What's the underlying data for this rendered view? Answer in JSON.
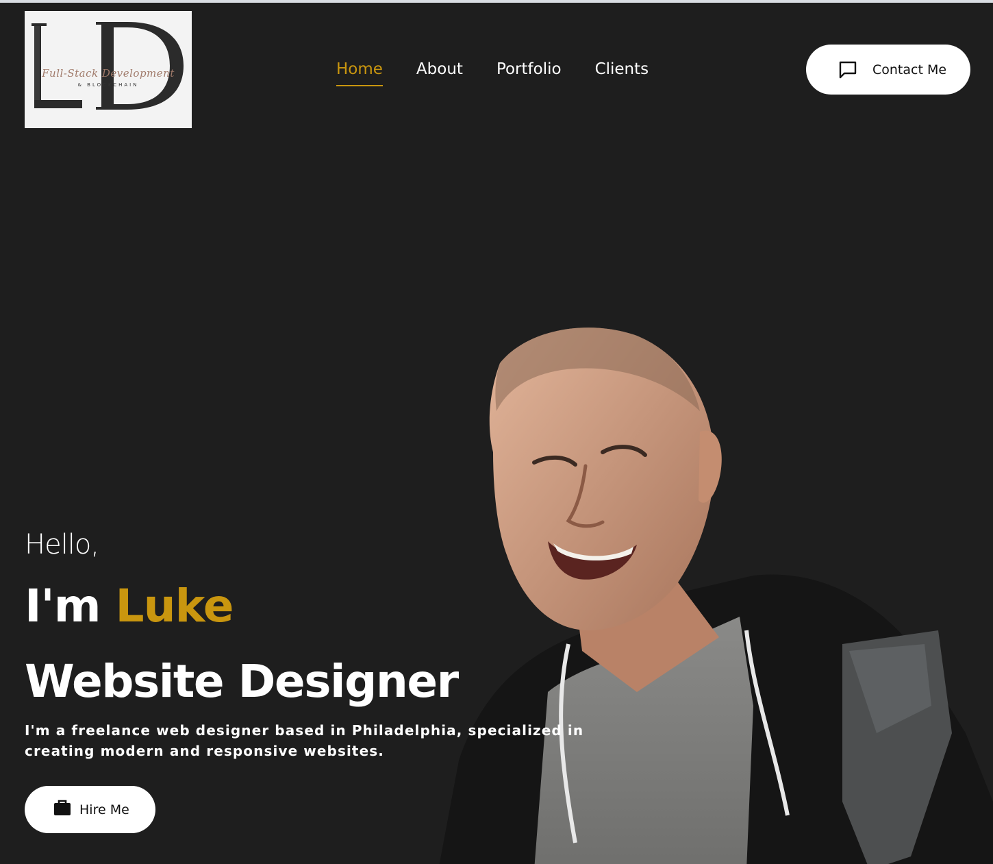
{
  "logo": {
    "letters": "LD",
    "tagline": "Full-Stack Development",
    "sub": "& BLOCKCHAIN"
  },
  "nav": {
    "items": [
      {
        "label": "Home",
        "active": true
      },
      {
        "label": "About",
        "active": false
      },
      {
        "label": "Portfolio",
        "active": false
      },
      {
        "label": "Clients",
        "active": false
      }
    ]
  },
  "header": {
    "contact_label": "Contact Me",
    "contact_icon": "chat-bubble-icon"
  },
  "hero": {
    "greeting": "Hello,",
    "intro_prefix": "I'm",
    "name": "Luke",
    "role": "Website Designer",
    "description": "I'm a freelance web designer based in Philadelphia, specialized in creating modern and responsive websites.",
    "hire_label": "Hire Me",
    "hire_icon": "briefcase-icon"
  },
  "colors": {
    "background": "#1e1e1e",
    "accent": "#c9960f",
    "text": "#ffffff",
    "button_bg": "#ffffff"
  }
}
